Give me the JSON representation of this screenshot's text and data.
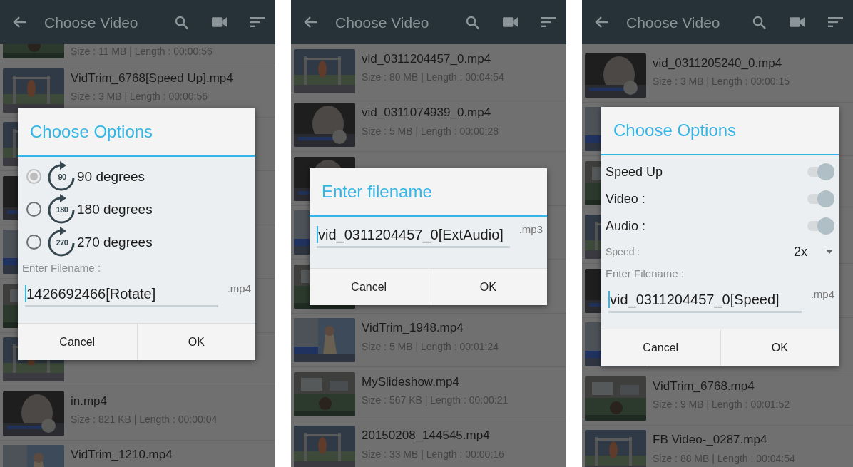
{
  "screens": [
    {
      "header": {
        "title": "Choose Video"
      },
      "videos_above": [
        {
          "meta": "Size : 11 MB | Length : 00:00:56"
        },
        {
          "name": "VidTrim_6768[Speed Up].mp4",
          "meta": "Size : 3 MB | Length : 00:00:56"
        }
      ],
      "videos_below": [
        {
          "name": "in.mp4",
          "meta": "Size : 821 KB | Length : 00:00:04"
        },
        {
          "name": "VidTrim_1210.mp4"
        }
      ],
      "dialog": {
        "title": "Choose Options",
        "options": [
          {
            "kind": "radio",
            "label": "90 degrees",
            "angle": "90",
            "selected": true
          },
          {
            "kind": "radio",
            "label": "180 degrees",
            "angle": "180",
            "selected": false
          },
          {
            "kind": "radio",
            "label": "270 degrees",
            "angle": "270",
            "selected": false
          }
        ],
        "filename_label": "Enter Filename :",
        "filename": "1426692466[Rotate]",
        "extension": ".mp4",
        "buttons": [
          "Cancel",
          "OK"
        ]
      }
    },
    {
      "header": {
        "title": "Choose Video"
      },
      "videos_above": [
        {
          "name": "vid_0311204457_0.mp4",
          "meta": "Size : 80 MB | Length : 00:04:54"
        },
        {
          "name": "vid_0311074939_0.mp4",
          "meta": "Size : 5 MB | Length : 00:00:28"
        }
      ],
      "videos_below": [
        {
          "name": "VidTrim_1948.mp4",
          "meta": "Size : 5 MB | Length : 00:01:24"
        },
        {
          "name": "MySlideshow.mp4",
          "meta": "Size : 567 KB | Length : 00:00:21"
        },
        {
          "name": "20150208_144545.mp4",
          "meta": "Size : 33 MB | Length : 00:00:16"
        }
      ],
      "dialog": {
        "title": "Enter filename",
        "filename": "vid_0311204457_0[ExtAudio]",
        "extension": ".mp3",
        "buttons": [
          "Cancel",
          "OK"
        ]
      }
    },
    {
      "header": {
        "title": "Choose Video"
      },
      "videos_above": [
        {
          "name": "vid_0311205240_0.mp4",
          "meta": "Size : 3 MB | Length : 00:00:15"
        }
      ],
      "videos_below": [
        {
          "name": "VidTrim_6768.mp4",
          "meta": "Size : 9 MB | Length : 00:01:52"
        },
        {
          "name": "FB Video-_0287.mp4",
          "meta": "Size : 88 MB | Length : 00:04:54"
        }
      ],
      "dialog": {
        "title": "Choose Options",
        "options": [
          {
            "kind": "switch",
            "label": "Speed Up",
            "on": true
          },
          {
            "kind": "switch",
            "label": "Video :",
            "on": true
          },
          {
            "kind": "switch",
            "label": "Audio :",
            "on": true
          },
          {
            "kind": "dropdown",
            "label": "Speed :",
            "value": "2x"
          }
        ],
        "filename_label": "Enter Filename :",
        "filename": "vid_0311204457_0[Speed]",
        "extension": ".mp4",
        "buttons": [
          "Cancel",
          "OK"
        ]
      }
    }
  ]
}
